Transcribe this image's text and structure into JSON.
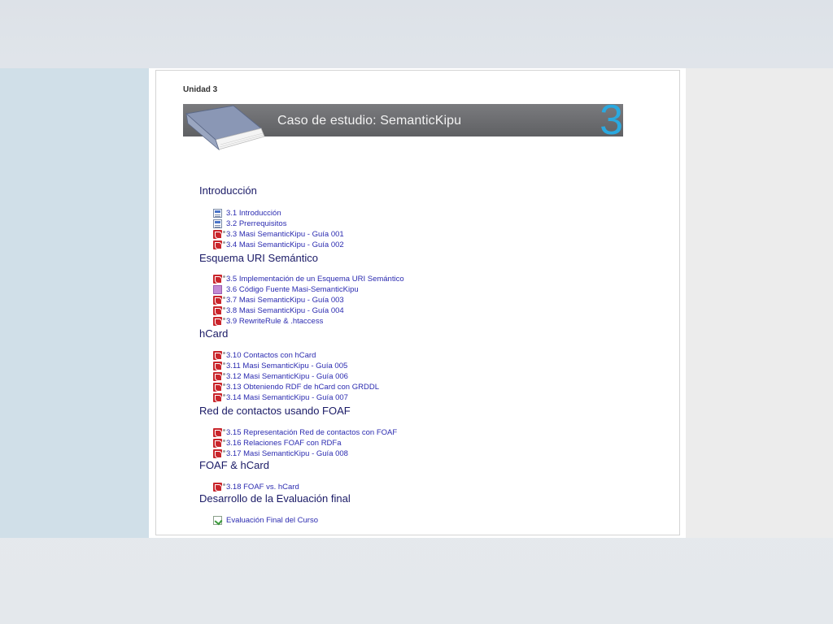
{
  "colors": {
    "heading": "#1a1a66",
    "link": "#2b2bb0",
    "accent_number": "#2aa9e0",
    "banner_bg": "#6b6c6f",
    "pdf_icon": "#c9252b"
  },
  "unit_label": "Unidad 3",
  "banner": {
    "title": "Caso de estudio: SemanticKipu",
    "number": "3",
    "icon": "book-icon"
  },
  "sections": [
    {
      "heading": "Introducción",
      "items": [
        {
          "icon": "page-icon",
          "label": "3.1 Introducción"
        },
        {
          "icon": "page-icon",
          "label": "3.2 Prerrequisitos"
        },
        {
          "icon": "pdf-icon",
          "label": "3.3 Masi SemanticKipu - Guía 001"
        },
        {
          "icon": "pdf-icon",
          "label": "3.4 Masi SemanticKipu - Guía 002"
        }
      ]
    },
    {
      "heading": "Esquema URI Semántico",
      "items": [
        {
          "icon": "pdf-icon",
          "label": "3.5 Implementación de un Esquema URI Semántico"
        },
        {
          "icon": "code-icon",
          "label": "3.6 Código Fuente Masi-SemanticKipu"
        },
        {
          "icon": "pdf-icon",
          "label": "3.7 Masi SemanticKipu - Guía 003"
        },
        {
          "icon": "pdf-icon",
          "label": "3.8 Masi SemanticKipu - Guía 004"
        },
        {
          "icon": "pdf-icon",
          "label": "3.9 RewriteRule & .htaccess"
        }
      ]
    },
    {
      "heading": "hCard",
      "items": [
        {
          "icon": "pdf-icon",
          "label": "3.10 Contactos con hCard"
        },
        {
          "icon": "pdf-icon",
          "label": "3.11 Masi SemanticKipu - Guía 005"
        },
        {
          "icon": "pdf-icon",
          "label": "3.12 Masi SemanticKipu - Guía 006"
        },
        {
          "icon": "pdf-icon",
          "label": "3.13 Obteniendo RDF de hCard con GRDDL"
        },
        {
          "icon": "pdf-icon",
          "label": "3.14 Masi SemanticKipu - Guía 007"
        }
      ]
    },
    {
      "heading": "Red de contactos usando FOAF",
      "items": [
        {
          "icon": "pdf-icon",
          "label": "3.15 Representación Red de contactos con FOAF"
        },
        {
          "icon": "pdf-icon",
          "label": "3.16 Relaciones FOAF con RDFa"
        },
        {
          "icon": "pdf-icon",
          "label": "3.17 Masi SemanticKipu - Guía 008"
        }
      ]
    },
    {
      "heading": "FOAF & hCard",
      "items": [
        {
          "icon": "pdf-icon",
          "label": "3.18 FOAF vs. hCard"
        }
      ]
    },
    {
      "heading": "Desarrollo de la Evaluación final",
      "items": [
        {
          "icon": "eval-icon",
          "label": "Evaluación Final del Curso"
        }
      ]
    }
  ]
}
